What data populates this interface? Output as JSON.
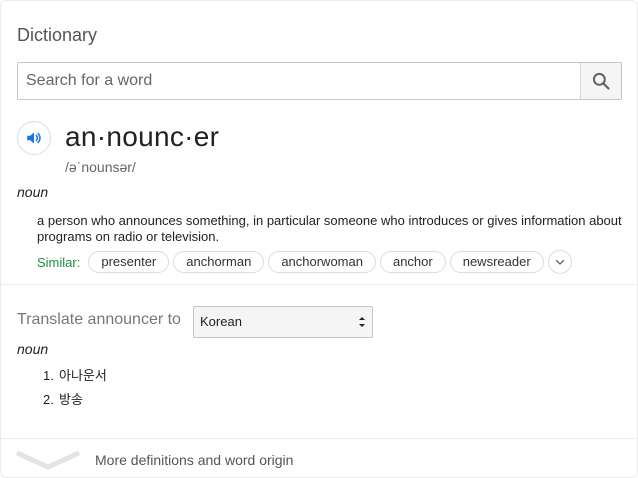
{
  "header": {
    "title": "Dictionary"
  },
  "search": {
    "placeholder": "Search for a word",
    "value": ""
  },
  "entry": {
    "headword": "an·nounc·er",
    "phonetic": "/əˈnounsər/",
    "part_of_speech": "noun",
    "definition": "a person who announces something, in particular someone who introduces or gives information about programs on radio or television.",
    "similar_label": "Similar:",
    "similar": [
      "presenter",
      "anchorman",
      "anchorwoman",
      "anchor",
      "newsreader"
    ]
  },
  "translate": {
    "label": "Translate announcer to",
    "language": "Korean",
    "part_of_speech": "noun",
    "items": [
      {
        "num": "1.",
        "text": "아나운서"
      },
      {
        "num": "2.",
        "text": "방송"
      }
    ]
  },
  "footer": {
    "more_label": "More definitions and word origin"
  },
  "colors": {
    "accent_blue": "#1a73e8",
    "similar_green": "#1e8e3e"
  },
  "icons": {
    "search": "search-icon",
    "speaker": "speaker-icon",
    "expand": "chevron-down-icon",
    "more": "chevron-down-icon"
  }
}
